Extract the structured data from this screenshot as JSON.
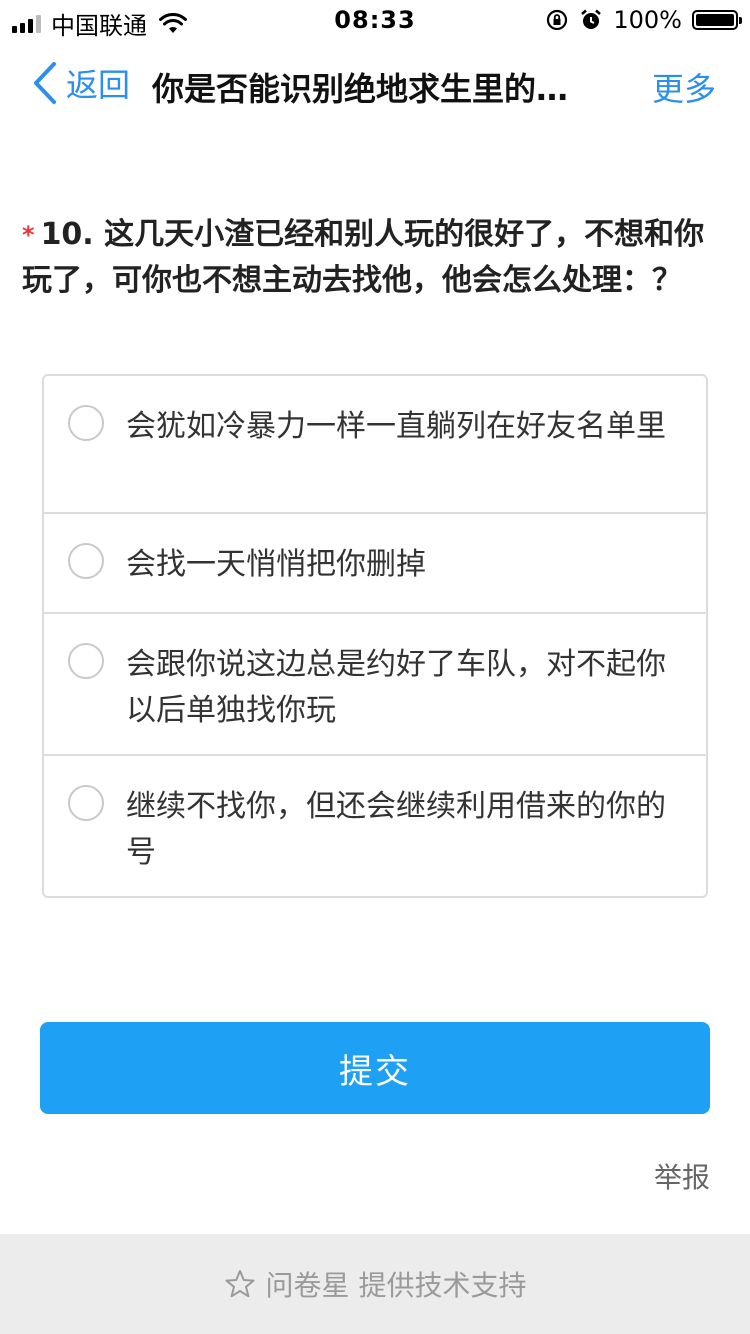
{
  "status_bar": {
    "carrier": "中国联通",
    "time": "08:33",
    "battery": "100%"
  },
  "nav": {
    "back_label": "返回",
    "title": "你是否能识别绝地求生里的…",
    "more_label": "更多"
  },
  "question": {
    "required_mark": "*",
    "number": "10.",
    "text": "这几天小渣已经和别人玩的很好了，不想和你玩了，可你也不想主动去找他，他会怎么处理：？"
  },
  "options": [
    {
      "label": "会犹如冷暴力一样一直躺列在好友名单里"
    },
    {
      "label": "会找一天悄悄把你删掉"
    },
    {
      "label": "会跟你说这边总是约好了车队，对不起你以后单独找你玩"
    },
    {
      "label": "继续不找你，但还会继续利用借来的你的号"
    }
  ],
  "submit_label": "提交",
  "report_label": "举报",
  "footer_text": "问卷星 提供技术支持",
  "colors": {
    "accent": "#2b8ff0",
    "submit_bg": "#1ea0f5",
    "required": "#e63a3a"
  }
}
